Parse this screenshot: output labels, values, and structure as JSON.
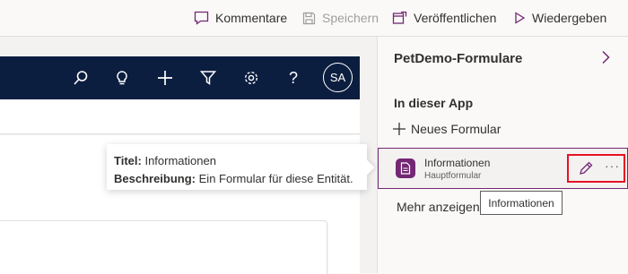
{
  "commandbar": {
    "comments": "Kommentare",
    "save": "Speichern",
    "publish": "Veröffentlichen",
    "play": "Wiedergeben"
  },
  "preview": {
    "avatar": "SA",
    "tooltip": {
      "title_label": "Titel:",
      "title_value": "Informationen",
      "desc_label": "Beschreibung:",
      "desc_value": "Ein Formular für diese Entität."
    }
  },
  "panel": {
    "title": "PetDemo-Formulare",
    "section": "In dieser App",
    "new_form": "Neues Formular",
    "form_item": {
      "name": "Informationen",
      "subtitle": "Hauptformular",
      "more": "···"
    },
    "show_more": "Mehr anzeigen",
    "hover_tooltip": "Informationen"
  },
  "colors": {
    "navbar": "#0c1e3f",
    "accent": "#742774",
    "highlight": "#e81123"
  }
}
